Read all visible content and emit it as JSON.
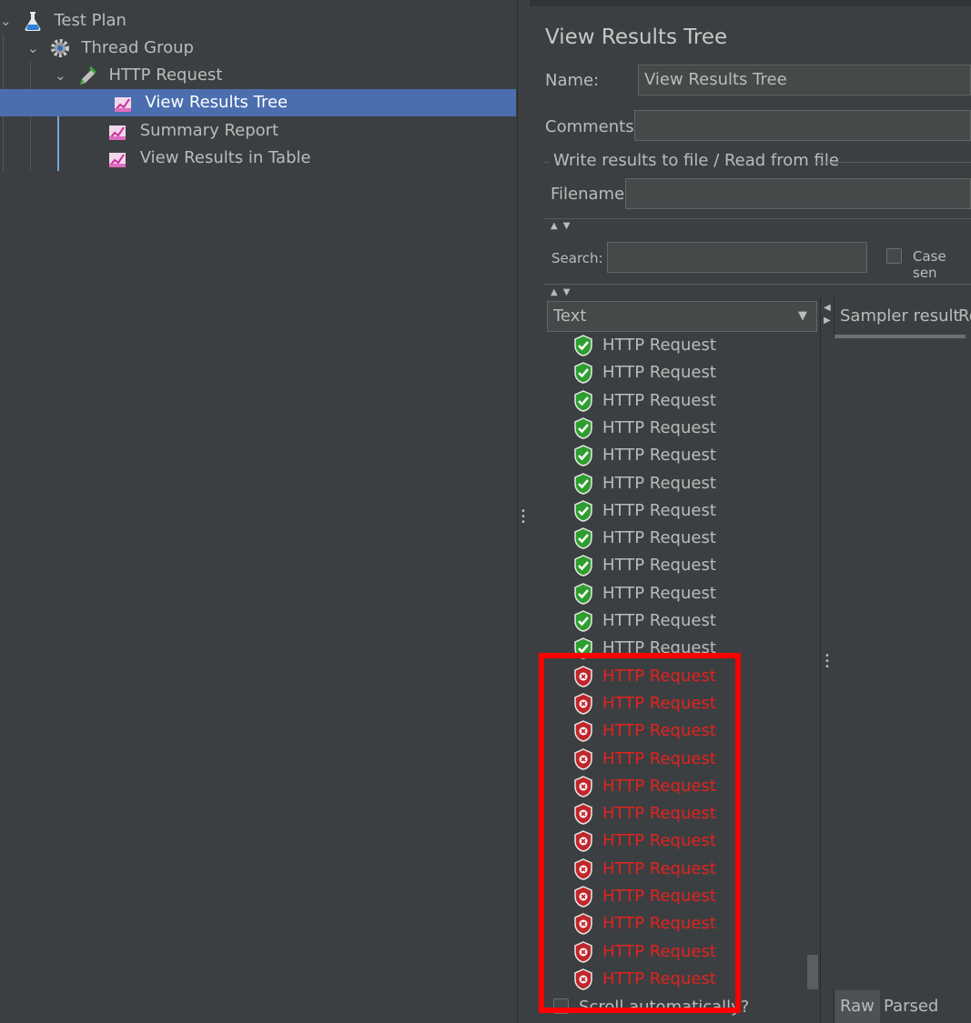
{
  "tree": {
    "items": [
      {
        "label": "Test Plan",
        "icon": "flask-icon"
      },
      {
        "label": "Thread Group",
        "icon": "gear-icon"
      },
      {
        "label": "HTTP Request",
        "icon": "pipette-icon"
      },
      {
        "label": "View Results Tree",
        "icon": "chart-icon",
        "selected": true
      },
      {
        "label": "Summary Report",
        "icon": "chart-icon"
      },
      {
        "label": "View Results in Table",
        "icon": "chart-icon"
      }
    ]
  },
  "panel": {
    "title": "View Results Tree",
    "name_label": "Name:",
    "name_value": "View Results Tree",
    "comments_label": "Comments:",
    "comments_value": "",
    "file_group_label": "Write results to file / Read from file",
    "filename_label": "Filename",
    "filename_value": "",
    "search_label": "Search:",
    "search_value": "",
    "case_sensitive_label": "Case sen",
    "renderer_select": "Text",
    "scroll_auto_label": "Scroll automatically?"
  },
  "results": {
    "items": [
      {
        "label": "HTTP Request",
        "status": "success"
      },
      {
        "label": "HTTP Request",
        "status": "success"
      },
      {
        "label": "HTTP Request",
        "status": "success"
      },
      {
        "label": "HTTP Request",
        "status": "success"
      },
      {
        "label": "HTTP Request",
        "status": "success"
      },
      {
        "label": "HTTP Request",
        "status": "success"
      },
      {
        "label": "HTTP Request",
        "status": "success"
      },
      {
        "label": "HTTP Request",
        "status": "success"
      },
      {
        "label": "HTTP Request",
        "status": "success"
      },
      {
        "label": "HTTP Request",
        "status": "success"
      },
      {
        "label": "HTTP Request",
        "status": "success"
      },
      {
        "label": "HTTP Request",
        "status": "success"
      },
      {
        "label": "HTTP Request",
        "status": "failure"
      },
      {
        "label": "HTTP Request",
        "status": "failure"
      },
      {
        "label": "HTTP Request",
        "status": "failure"
      },
      {
        "label": "HTTP Request",
        "status": "failure"
      },
      {
        "label": "HTTP Request",
        "status": "failure"
      },
      {
        "label": "HTTP Request",
        "status": "failure"
      },
      {
        "label": "HTTP Request",
        "status": "failure"
      },
      {
        "label": "HTTP Request",
        "status": "failure"
      },
      {
        "label": "HTTP Request",
        "status": "failure"
      },
      {
        "label": "HTTP Request",
        "status": "failure"
      },
      {
        "label": "HTTP Request",
        "status": "failure"
      },
      {
        "label": "HTTP Request",
        "status": "failure"
      }
    ]
  },
  "detail_tabs": {
    "sampler_result": "Sampler result",
    "request_partial": "Re",
    "raw": "Raw",
    "parsed": "Parsed"
  },
  "colors": {
    "background": "#3c3f41",
    "selection": "#4b6eaf",
    "success": "#2e9e2e",
    "failure": "#e0231f",
    "highlight": "#ff0000"
  }
}
